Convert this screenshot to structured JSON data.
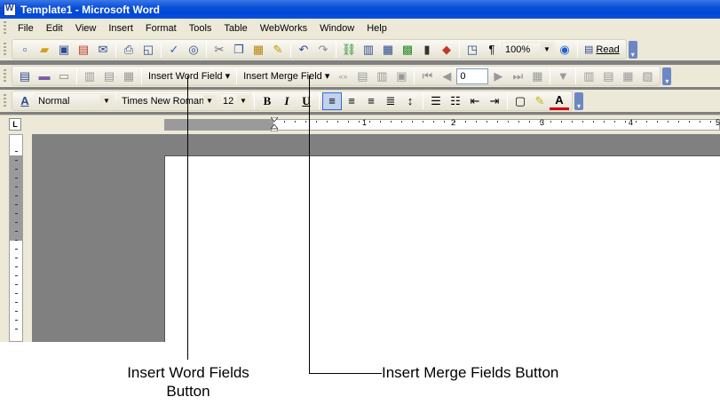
{
  "window": {
    "title": "Template1 - Microsoft Word"
  },
  "menu": {
    "items": [
      "File",
      "Edit",
      "View",
      "Insert",
      "Format",
      "Tools",
      "Table",
      "WebWorks",
      "Window",
      "Help"
    ]
  },
  "standard_toolbar": {
    "zoom": "100%",
    "read_label": "Read"
  },
  "mailmerge_toolbar": {
    "insert_word_field": "Insert Word Field ▾",
    "insert_merge_field": "Insert Merge Field ▾",
    "record_number": "0"
  },
  "formatting_toolbar": {
    "style": "Normal",
    "font": "Times New Roman",
    "size": "12",
    "bold": "B",
    "italic": "I",
    "underline": "U"
  },
  "ruler": {
    "corner": "L",
    "numbers": [
      "1",
      "2",
      "3",
      "4",
      "5"
    ]
  },
  "callouts": {
    "word_fields_line1": "Insert Word Fields",
    "word_fields_line2": "Button",
    "merge_fields": "Insert Merge Fields Button"
  },
  "colors": {
    "titlebar": "#0a4fd9",
    "toolbar_bg": "#ece9d8",
    "workspace": "#808080"
  }
}
